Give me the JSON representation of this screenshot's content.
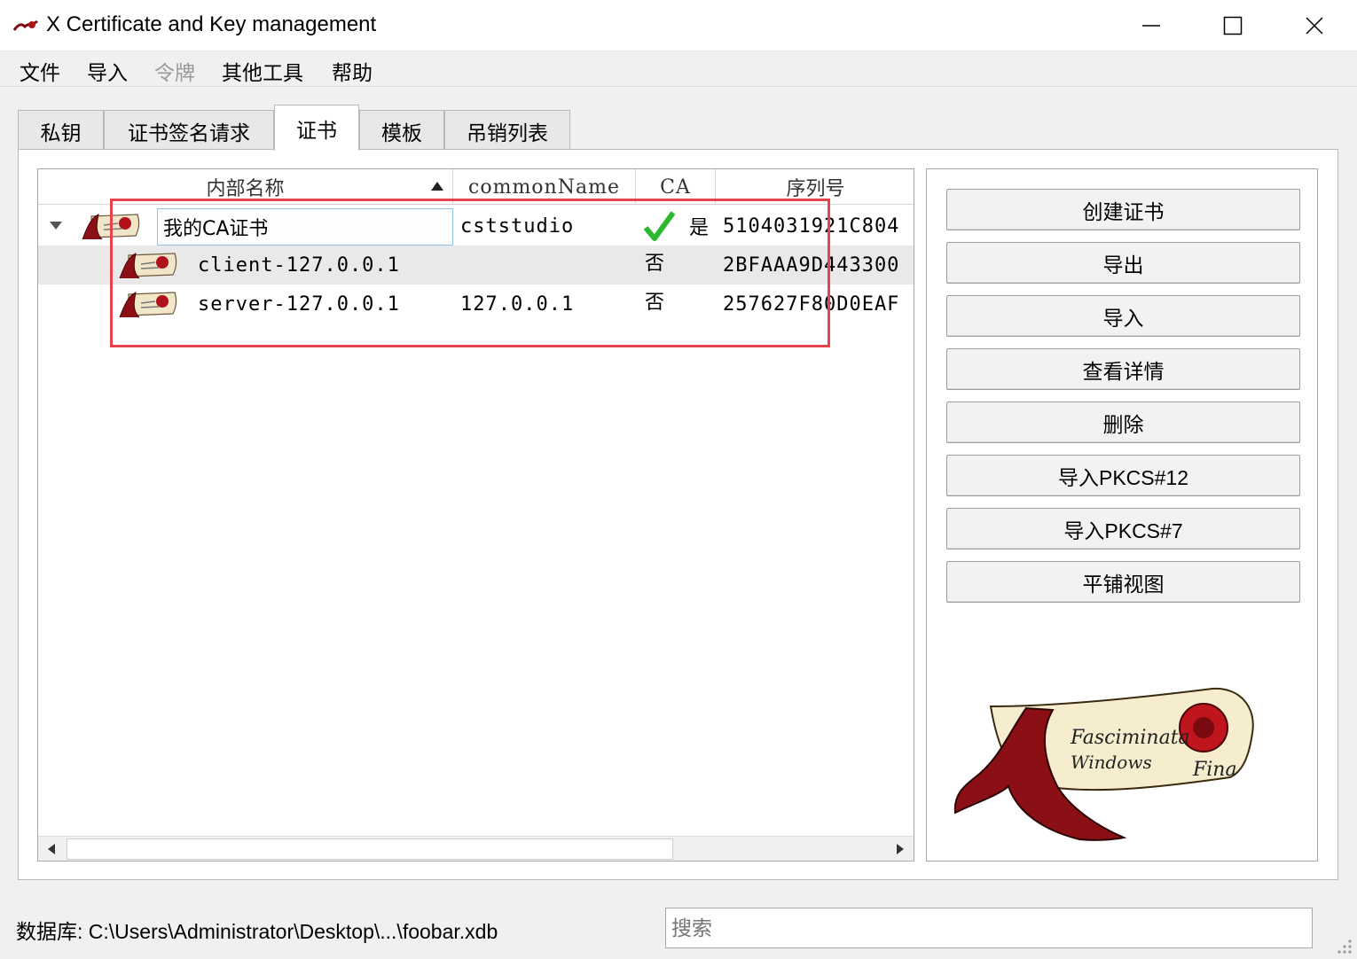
{
  "window": {
    "title": "X Certificate and Key management",
    "min_glyph": "—",
    "max_glyph": "☐",
    "close_glyph": "✕"
  },
  "menu": [
    {
      "label": "文件",
      "enabled": true
    },
    {
      "label": "导入",
      "enabled": true
    },
    {
      "label": "令牌",
      "enabled": false
    },
    {
      "label": "其他工具",
      "enabled": true
    },
    {
      "label": "帮助",
      "enabled": true
    }
  ],
  "tabs": [
    {
      "label": "私钥",
      "active": false
    },
    {
      "label": "证书签名请求",
      "active": false
    },
    {
      "label": "证书",
      "active": true
    },
    {
      "label": "模板",
      "active": false
    },
    {
      "label": "吊销列表",
      "active": false
    }
  ],
  "table": {
    "columns": [
      "内部名称",
      "commonName",
      "CA",
      "序列号"
    ],
    "sort_column": "内部名称",
    "sort_order": "ascending",
    "rows": [
      {
        "name": "我的CA证书",
        "common_name": "cststudio",
        "ca": "是",
        "ca_check": true,
        "serial": "5104031921C804",
        "expanded": true,
        "editing": true
      },
      {
        "name": "client-127.0.0.1",
        "common_name": "",
        "ca": "否",
        "ca_check": false,
        "serial": "2BFAAA9D443300"
      },
      {
        "name": "server-127.0.0.1",
        "common_name": "127.0.0.1",
        "ca": "否",
        "ca_check": false,
        "serial": "257627F80D0EAF"
      }
    ]
  },
  "actions": [
    "创建证书",
    "导出",
    "导入",
    "查看详情",
    "删除",
    "导入PKCS#12",
    "导入PKCS#7",
    "平铺视图"
  ],
  "logo_text": [
    "Fasciminata",
    "Windows",
    "Fina"
  ],
  "status": {
    "database_label": "数据库: C:\\Users\\Administrator\\Desktop\\...\\foobar.xdb"
  },
  "search": {
    "placeholder": "搜索",
    "value": ""
  },
  "colors": {
    "accent_highlight": "#e8434b",
    "check_green": "#2eb82e",
    "seal_red": "#b0121b"
  }
}
